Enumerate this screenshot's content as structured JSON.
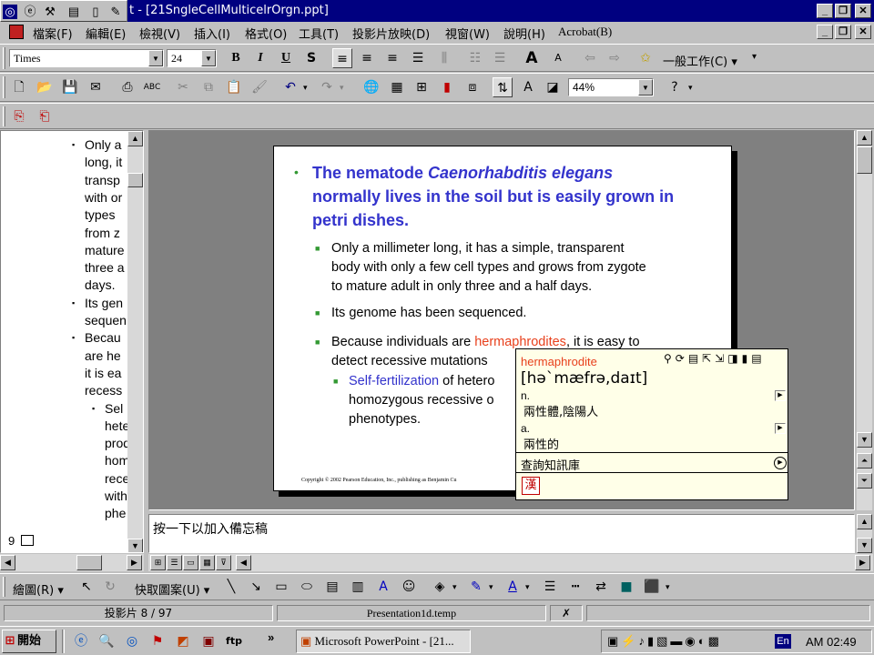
{
  "titlebar": {
    "title": "t - [21SngleCellMulticelrOrgn.ppt]",
    "buttons": [
      "_",
      "🗗",
      "✕"
    ]
  },
  "menubar": {
    "items": [
      "檔案(F)",
      "編輯(E)",
      "檢視(V)",
      "插入(I)",
      "格式(O)",
      "工具(T)",
      "投影片放映(D)",
      "視窗(W)",
      "說明(H)",
      "Acrobat(B)"
    ]
  },
  "format_toolbar": {
    "font": "Times",
    "size": "24",
    "task_label": "一般工作(C)"
  },
  "standard_toolbar": {
    "zoom": "44%"
  },
  "outline": {
    "lines": [
      {
        "bullet": "▪",
        "text": "Only a"
      },
      {
        "text": "long, it"
      },
      {
        "text": "transp"
      },
      {
        "text": "with or"
      },
      {
        "text": "types"
      },
      {
        "text": "from z"
      },
      {
        "text": "mature"
      },
      {
        "text": "three a"
      },
      {
        "text": "days."
      },
      {
        "bullet": "▪",
        "text": "Its gen"
      },
      {
        "text": "sequen"
      },
      {
        "bullet": "▪",
        "text": "Becau"
      },
      {
        "text": "are he"
      },
      {
        "text": "it is ea"
      },
      {
        "text": "recess"
      },
      {
        "bullet": "▪",
        "text": "Sel"
      },
      {
        "text": "hete"
      },
      {
        "text": "prod"
      },
      {
        "text": "hom"
      },
      {
        "text": "rece"
      },
      {
        "text": "with"
      },
      {
        "text": "phe"
      }
    ],
    "slide_number": "9"
  },
  "slide": {
    "heading_lines": [
      "The nematode ",
      "Caenorhabditis elegans",
      "normally lives in the soil but is easily grown in",
      "petri dishes."
    ],
    "bullet1": [
      "Only a millimeter long, it has a simple, transparent",
      "body with only a few cell types and grows from zygote",
      "to mature adult in only three and a half days."
    ],
    "bullet2": "Its genome has been sequenced.",
    "bullet3_pre": "Because individuals are ",
    "bullet3_highlight": "hermaphrodites",
    "bullet3_post": ", it is easy to",
    "bullet3_line2": "detect recessive mutations",
    "sub_bullet_highlight": "Self-fertilization",
    "sub_bullet_post": " of hetero",
    "sub_line2": "homozygous recessive o",
    "sub_line3": "phenotypes.",
    "copyright": "Copyright © 2002 Pearson Education, Inc., publishing as Benjamin Cu"
  },
  "dictionary": {
    "word": "hermaphrodite",
    "phonetic": "[hə`mæfrə,daɪt]",
    "entries": [
      {
        "pos": "n.",
        "meaning": "兩性體,陰陽人"
      },
      {
        "pos": "a.",
        "meaning": "兩性的"
      }
    ],
    "query_label": "查詢知訊庫",
    "han_label": "漢"
  },
  "notes": {
    "placeholder": "按一下以加入備忘稿"
  },
  "drawing_toolbar": {
    "draw_label": "繪圖(R)",
    "autoshape_label": "快取圖案(U)"
  },
  "statusbar": {
    "slide_info": "投影片 8 / 97",
    "template": "Presentation1d.temp"
  },
  "taskbar": {
    "start_label": "開始",
    "task_label": "Microsoft PowerPoint - [21...",
    "clock": "AM 02:49",
    "lang": "En"
  }
}
